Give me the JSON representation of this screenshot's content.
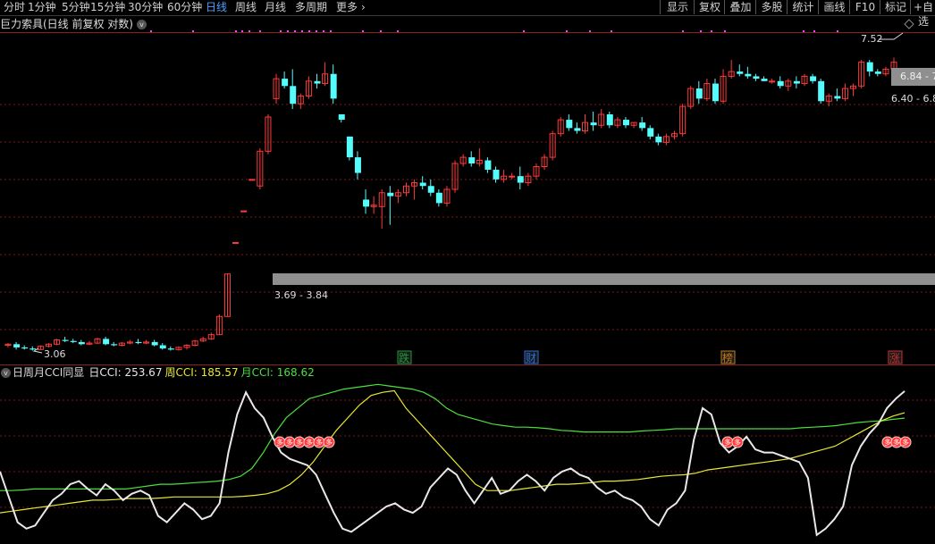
{
  "toolbar": {
    "periods": [
      "分时",
      "1分钟",
      "5分钟",
      "15分钟",
      "30分钟",
      "60分钟",
      "日线",
      "周线",
      "月线",
      "多周期",
      "更多"
    ],
    "active_period": "日线",
    "more_arrow": "›",
    "right_buttons": [
      "显示",
      "复权",
      "叠加",
      "多股",
      "统计",
      "画线",
      "F10",
      "标记",
      "+自选"
    ]
  },
  "main_chart": {
    "title": "巨力索具(日线 前复权 对数)",
    "collapse_icon": "chevron-down-icon",
    "price_label_top": "7.52",
    "price_range_high": "6.84 - 7",
    "price_range_mid": "6.40 - 6.8",
    "price_range_low": "3.69 - 3.84",
    "low_marker": "3.06",
    "event_badges": [
      {
        "label": "跌",
        "color": "#1e9a3a"
      },
      {
        "label": "财",
        "color": "#2a6fd6"
      },
      {
        "label": "榜",
        "color": "#c87c1a"
      },
      {
        "label": "涨",
        "color": "#c83030"
      }
    ],
    "up_color": "#ff3a3a",
    "down_color": "#54fcfc",
    "marker_color": "#ff3cff"
  },
  "chart_data": {
    "type": "candlestick",
    "candles": [
      [
        3.1,
        3.12,
        3.08,
        3.11
      ],
      [
        3.11,
        3.13,
        3.06,
        3.08
      ],
      [
        3.08,
        3.1,
        3.06,
        3.07
      ],
      [
        3.07,
        3.09,
        3.05,
        3.06
      ],
      [
        3.06,
        3.1,
        3.06,
        3.09
      ],
      [
        3.09,
        3.12,
        3.08,
        3.11
      ],
      [
        3.11,
        3.16,
        3.1,
        3.15
      ],
      [
        3.15,
        3.18,
        3.13,
        3.14
      ],
      [
        3.14,
        3.16,
        3.12,
        3.13
      ],
      [
        3.13,
        3.15,
        3.1,
        3.11
      ],
      [
        3.11,
        3.14,
        3.1,
        3.12
      ],
      [
        3.12,
        3.17,
        3.11,
        3.16
      ],
      [
        3.16,
        3.18,
        3.1,
        3.11
      ],
      [
        3.11,
        3.13,
        3.09,
        3.1
      ],
      [
        3.1,
        3.13,
        3.09,
        3.12
      ],
      [
        3.12,
        3.15,
        3.11,
        3.13
      ],
      [
        3.13,
        3.16,
        3.11,
        3.12
      ],
      [
        3.12,
        3.15,
        3.11,
        3.13
      ],
      [
        3.13,
        3.15,
        3.09,
        3.1
      ],
      [
        3.1,
        3.12,
        3.06,
        3.07
      ],
      [
        3.07,
        3.09,
        3.05,
        3.06
      ],
      [
        3.06,
        3.09,
        3.05,
        3.08
      ],
      [
        3.08,
        3.11,
        3.06,
        3.1
      ],
      [
        3.1,
        3.15,
        3.09,
        3.14
      ],
      [
        3.14,
        3.18,
        3.13,
        3.16
      ],
      [
        3.16,
        3.22,
        3.15,
        3.2
      ],
      [
        3.2,
        3.4,
        3.2,
        3.38
      ],
      [
        3.38,
        3.84,
        3.38,
        3.84
      ],
      [
        4.22,
        4.22,
        4.22,
        4.22
      ],
      [
        4.64,
        4.64,
        4.64,
        4.64
      ],
      [
        5.1,
        5.1,
        5.1,
        5.1
      ],
      [
        5.0,
        5.6,
        4.95,
        5.55
      ],
      [
        5.55,
        6.2,
        5.5,
        6.15
      ],
      [
        6.5,
        7.0,
        6.4,
        6.9
      ],
      [
        6.9,
        7.05,
        6.7,
        6.75
      ],
      [
        6.75,
        7.1,
        6.3,
        6.4
      ],
      [
        6.4,
        6.6,
        6.3,
        6.55
      ],
      [
        6.55,
        6.95,
        6.5,
        6.85
      ],
      [
        6.85,
        7.0,
        6.7,
        6.8
      ],
      [
        6.8,
        7.25,
        6.75,
        7.0
      ],
      [
        7.0,
        7.2,
        6.4,
        6.5
      ],
      [
        6.2,
        6.2,
        6.05,
        6.1
      ],
      [
        5.8,
        5.8,
        5.4,
        5.45
      ],
      [
        5.45,
        5.55,
        5.1,
        5.2
      ],
      [
        4.8,
        4.95,
        4.6,
        4.7
      ],
      [
        4.7,
        4.85,
        4.6,
        4.72
      ],
      [
        4.7,
        4.95,
        4.4,
        4.9
      ],
      [
        4.9,
        5.0,
        4.45,
        4.85
      ],
      [
        4.85,
        4.95,
        4.75,
        4.9
      ],
      [
        4.9,
        5.05,
        4.85,
        5.0
      ],
      [
        5.0,
        5.1,
        4.8,
        5.05
      ],
      [
        5.05,
        5.15,
        4.95,
        5.0
      ],
      [
        5.0,
        5.1,
        4.85,
        4.9
      ],
      [
        4.9,
        4.95,
        4.7,
        4.75
      ],
      [
        4.75,
        5.0,
        4.7,
        4.95
      ],
      [
        4.95,
        5.4,
        4.9,
        5.35
      ],
      [
        5.35,
        5.5,
        5.3,
        5.45
      ],
      [
        5.45,
        5.55,
        5.3,
        5.35
      ],
      [
        5.35,
        5.6,
        5.3,
        5.4
      ],
      [
        5.4,
        5.45,
        5.2,
        5.25
      ],
      [
        5.25,
        5.3,
        5.05,
        5.1
      ],
      [
        5.1,
        5.25,
        5.05,
        5.15
      ],
      [
        5.15,
        5.2,
        5.1,
        5.15
      ],
      [
        5.15,
        5.3,
        4.95,
        5.05
      ],
      [
        5.05,
        5.2,
        5.0,
        5.15
      ],
      [
        5.15,
        5.35,
        5.1,
        5.3
      ],
      [
        5.3,
        5.5,
        5.25,
        5.45
      ],
      [
        5.45,
        5.9,
        5.4,
        5.85
      ],
      [
        5.85,
        6.15,
        5.8,
        6.1
      ],
      [
        6.1,
        6.2,
        5.9,
        5.95
      ],
      [
        5.95,
        6.05,
        5.85,
        5.9
      ],
      [
        5.9,
        6.2,
        5.85,
        6.05
      ],
      [
        6.05,
        6.25,
        5.9,
        6.0
      ],
      [
        6.0,
        6.3,
        5.95,
        6.2
      ],
      [
        6.2,
        6.25,
        5.95,
        6.0
      ],
      [
        6.0,
        6.15,
        5.95,
        6.1
      ],
      [
        6.1,
        6.15,
        5.95,
        6.0
      ],
      [
        6.0,
        6.05,
        5.95,
        6.05
      ],
      [
        6.05,
        6.15,
        5.9,
        5.95
      ],
      [
        5.95,
        6.0,
        5.75,
        5.8
      ],
      [
        5.8,
        5.85,
        5.65,
        5.7
      ],
      [
        5.7,
        5.85,
        5.65,
        5.8
      ],
      [
        5.8,
        5.9,
        5.75,
        5.85
      ],
      [
        5.85,
        6.4,
        5.8,
        6.35
      ],
      [
        6.35,
        6.75,
        6.3,
        6.7
      ],
      [
        6.7,
        6.85,
        6.4,
        6.5
      ],
      [
        6.5,
        6.9,
        6.45,
        6.8
      ],
      [
        6.8,
        6.9,
        6.4,
        6.45
      ],
      [
        6.45,
        7.1,
        6.4,
        6.95
      ],
      [
        6.95,
        7.3,
        6.9,
        7.05
      ],
      [
        7.05,
        7.2,
        6.95,
        7.0
      ],
      [
        7.0,
        7.15,
        6.9,
        6.95
      ],
      [
        6.95,
        7.0,
        6.85,
        6.9
      ],
      [
        6.9,
        6.95,
        6.85,
        6.85
      ],
      [
        6.85,
        6.9,
        6.8,
        6.85
      ],
      [
        6.85,
        6.95,
        6.7,
        6.75
      ],
      [
        6.75,
        6.9,
        6.65,
        6.85
      ],
      [
        6.85,
        6.95,
        6.7,
        6.8
      ],
      [
        6.8,
        7.0,
        6.75,
        6.95
      ],
      [
        6.95,
        7.0,
        6.8,
        6.85
      ],
      [
        6.85,
        6.9,
        6.4,
        6.45
      ],
      [
        6.45,
        6.6,
        6.35,
        6.55
      ],
      [
        6.55,
        6.7,
        6.45,
        6.5
      ],
      [
        6.5,
        6.8,
        6.45,
        6.7
      ],
      [
        6.7,
        6.8,
        6.55,
        6.75
      ],
      [
        6.75,
        7.3,
        6.7,
        7.25
      ],
      [
        7.25,
        7.3,
        6.95,
        7.05
      ],
      [
        7.05,
        7.1,
        6.95,
        7.0
      ],
      [
        7.0,
        7.15,
        6.95,
        7.1
      ],
      [
        7.1,
        7.35,
        7.05,
        7.25
      ]
    ],
    "price_scale": "log",
    "price_range": [
      2.95,
      7.85
    ],
    "low_price": 3.06,
    "top_price": 7.52
  },
  "indicator": {
    "title": "日周月CCI同显",
    "entries": [
      {
        "label": "日CCI: 253.67",
        "color": "#e8e8e8"
      },
      {
        "label": "周CCI: 185.57",
        "color": "#e8e830"
      },
      {
        "label": "月CCI: 168.62",
        "color": "#4be03c"
      }
    ],
    "badge_glyph": "多",
    "day_cci": [
      0,
      -80,
      -160,
      -180,
      -170,
      -130,
      -90,
      -70,
      -40,
      -30,
      -55,
      -75,
      -40,
      -60,
      -90,
      -70,
      -60,
      -75,
      -140,
      -160,
      -130,
      -100,
      -120,
      -150,
      -140,
      -100,
      60,
      180,
      250,
      200,
      170,
      110,
      60,
      40,
      30,
      20,
      -10,
      -70,
      -130,
      -180,
      -190,
      -170,
      -150,
      -130,
      -110,
      -100,
      -120,
      -130,
      -110,
      -50,
      -20,
      10,
      -10,
      -60,
      -100,
      -60,
      -20,
      -70,
      -60,
      -30,
      -10,
      -30,
      -60,
      -20,
      0,
      10,
      -10,
      -20,
      -50,
      -70,
      -60,
      -80,
      -90,
      -110,
      -150,
      -170,
      -120,
      -100,
      -60,
      100,
      200,
      180,
      90,
      60,
      80,
      110,
      70,
      60,
      60,
      50,
      40,
      30,
      -20,
      -200,
      -180,
      -150,
      -110,
      20,
      80,
      120,
      150,
      200,
      230,
      253.67
    ],
    "week_cci": [
      -130,
      -125,
      -120,
      -115,
      -110,
      -105,
      -100,
      -95,
      -90,
      -90,
      -88,
      -85,
      -85,
      -85,
      -83,
      -80,
      -80,
      -80,
      -80,
      -80,
      -80,
      -78,
      -75,
      -70,
      -60,
      -40,
      -10,
      30,
      80,
      130,
      170,
      210,
      240,
      250,
      255,
      200,
      160,
      120,
      80,
      40,
      0,
      -40,
      -60,
      -60,
      -60,
      -55,
      -50,
      -45,
      -40,
      -40,
      -38,
      -35,
      -30,
      -30,
      -28,
      -25,
      -20,
      -15,
      -12,
      -10,
      -5,
      5,
      10,
      15,
      20,
      25,
      30,
      35,
      40,
      50,
      60,
      70,
      80,
      100,
      120,
      140,
      160,
      175,
      185.57
    ],
    "month_cci": [
      -60,
      -60,
      -58,
      -55,
      -55,
      -55,
      -55,
      -55,
      -55,
      -55,
      -55,
      -55,
      -50,
      -45,
      -40,
      -40,
      -38,
      -35,
      -33,
      -30,
      -25,
      -15,
      10,
      60,
      120,
      170,
      200,
      230,
      240,
      250,
      260,
      265,
      270,
      275,
      270,
      265,
      260,
      250,
      230,
      200,
      180,
      170,
      160,
      150,
      145,
      140,
      140,
      138,
      135,
      130,
      128,
      125,
      125,
      125,
      125,
      125,
      128,
      130,
      132,
      135,
      135,
      135,
      135,
      135,
      135,
      135,
      135,
      135,
      135,
      135,
      138,
      140,
      142,
      145,
      150,
      155,
      158,
      160,
      165,
      168.62
    ]
  }
}
